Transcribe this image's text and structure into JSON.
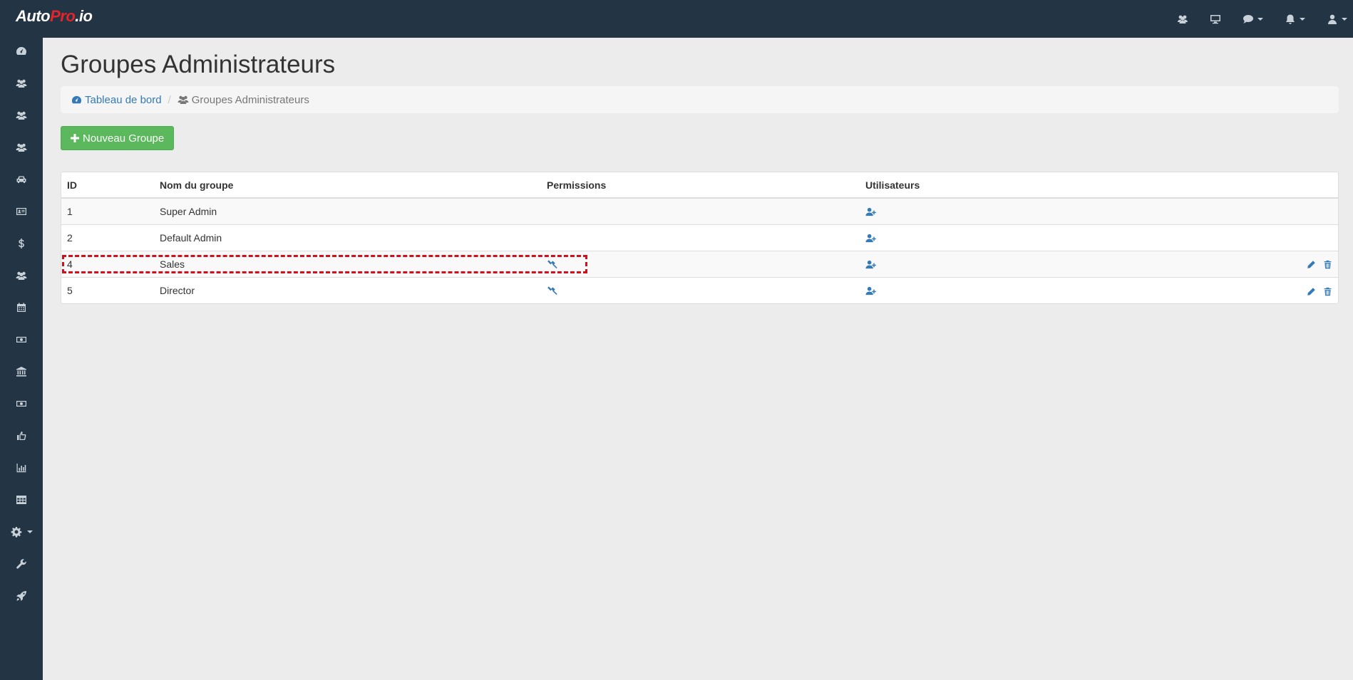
{
  "app": {
    "logo_part1": "Auto",
    "logo_part2": "Pro",
    "logo_part3": ".io"
  },
  "topnav": [
    {
      "icon": "users-icon",
      "dropdown": false
    },
    {
      "icon": "monitor-icon",
      "dropdown": false
    },
    {
      "icon": "chat-icon",
      "dropdown": true
    },
    {
      "icon": "bell-icon",
      "dropdown": true
    },
    {
      "icon": "user-icon",
      "dropdown": true
    }
  ],
  "sidebar": [
    "dashboard-icon",
    "users-icon",
    "users-icon",
    "users-icon",
    "car-icon",
    "id-card-icon",
    "dollar-icon",
    "users-icon",
    "calendar-icon",
    "money-icon",
    "bank-icon",
    "money-icon",
    "thumbs-up-icon",
    "bar-chart-icon",
    "table-icon",
    "gear-icon",
    "wrench-icon",
    "rocket-icon"
  ],
  "page": {
    "title": "Groupes Administrateurs"
  },
  "breadcrumb": {
    "home_label": "Tableau de bord",
    "current_label": "Groupes Administrateurs"
  },
  "new_group_button": "Nouveau Groupe",
  "table": {
    "headers": {
      "id": "ID",
      "name": "Nom du groupe",
      "permissions": "Permissions",
      "users": "Utilisateurs"
    },
    "rows": [
      {
        "id": "1",
        "name": "Super Admin",
        "has_permissions": false,
        "has_actions": false
      },
      {
        "id": "2",
        "name": "Default Admin",
        "has_permissions": false,
        "has_actions": false
      },
      {
        "id": "4",
        "name": "Sales",
        "has_permissions": true,
        "has_actions": true,
        "highlighted": true
      },
      {
        "id": "5",
        "name": "Director",
        "has_permissions": true,
        "has_actions": true
      }
    ]
  },
  "colors": {
    "navbar": "#233444",
    "link": "#337ab7",
    "success": "#5cb85c",
    "highlight": "#d0111b"
  }
}
